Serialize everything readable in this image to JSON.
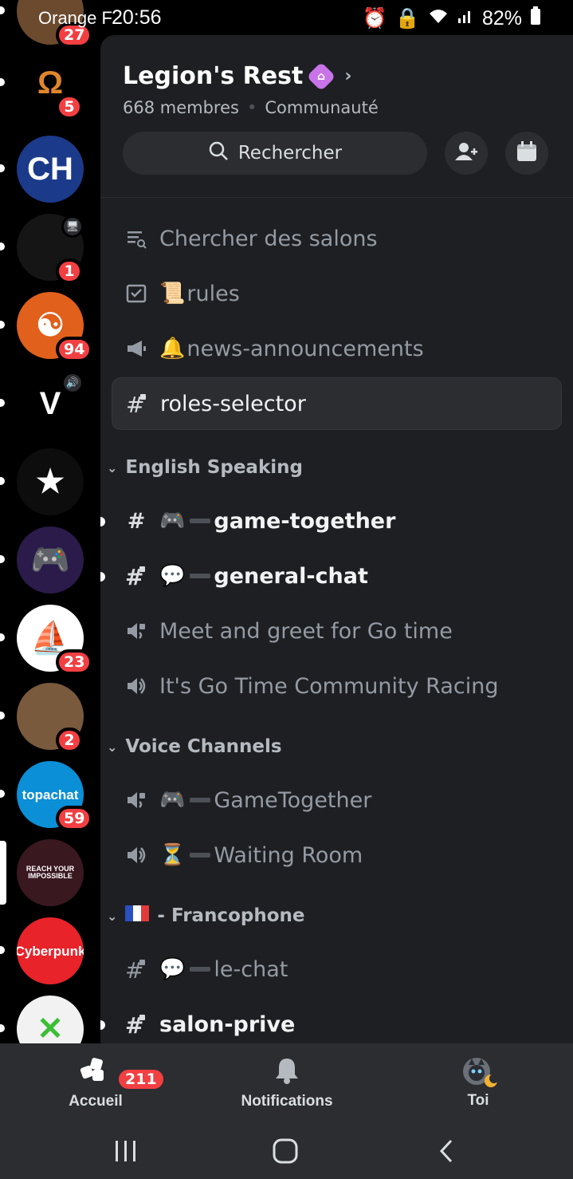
{
  "status_bar": {
    "carrier": "Orange F",
    "time": "20:56",
    "battery": "82%"
  },
  "servers": [
    {
      "id": "s0",
      "badge": "27",
      "color": "#6b4a2e",
      "glyph": ""
    },
    {
      "id": "s1",
      "badge": "5",
      "color": "#000000",
      "glyph": "Ω"
    },
    {
      "id": "s2",
      "badge": "",
      "color": "#1b3a8a",
      "glyph": "CH"
    },
    {
      "id": "s3",
      "badge": "1",
      "color": "#151515",
      "glyph": ""
    },
    {
      "id": "s4",
      "badge": "94",
      "color": "#e0601c",
      "glyph": "☯"
    },
    {
      "id": "s5",
      "badge": "",
      "color": "#000000",
      "glyph": "V"
    },
    {
      "id": "s6",
      "badge": "",
      "color": "#0d0d0d",
      "glyph": "★"
    },
    {
      "id": "s7",
      "badge": "",
      "color": "#2a1b4a",
      "glyph": "🎮"
    },
    {
      "id": "s8",
      "badge": "23",
      "color": "#ffffff",
      "glyph": "⛵"
    },
    {
      "id": "s9",
      "badge": "2",
      "color": "#7a5a3c",
      "glyph": ""
    },
    {
      "id": "s10",
      "badge": "59",
      "color": "#0b8fd6",
      "glyph": "topachat"
    },
    {
      "id": "s11",
      "badge": "",
      "color": "#3a1820",
      "glyph": "REACH YOUR IMPOSSIBLE"
    },
    {
      "id": "s12",
      "badge": "",
      "color": "#e8232a",
      "glyph": "Cyberpunk"
    },
    {
      "id": "s13",
      "badge": "",
      "color": "#f2f2f2",
      "glyph": "✕"
    }
  ],
  "guild": {
    "name": "Legion's Rest",
    "members": "668 membres",
    "type": "Communauté",
    "search_label": "Rechercher"
  },
  "channels": {
    "browse": "Chercher des salons",
    "rules": "rules",
    "news": "news-announcements",
    "roles": "roles-selector",
    "cat_english": "English Speaking",
    "game_together": "game-together",
    "general_chat": "general-chat",
    "meet_greet": "Meet and greet for Go time",
    "go_time": "It's Go Time Community Racing",
    "cat_voice": "Voice Channels",
    "voice_game": "GameTogether",
    "waiting_room": "Waiting Room",
    "cat_franco": "- Francophone",
    "le_chat": "le-chat",
    "salon_prive": "salon-prive"
  },
  "bottom_nav": {
    "home": "Accueil",
    "home_badge": "211",
    "notifications": "Notifications",
    "you": "Toi"
  },
  "colors": {
    "accent_red": "#f23f42",
    "boost_purple": "#c874e8",
    "panel_bg": "#1e1f22",
    "rail_bg": "#000000"
  }
}
